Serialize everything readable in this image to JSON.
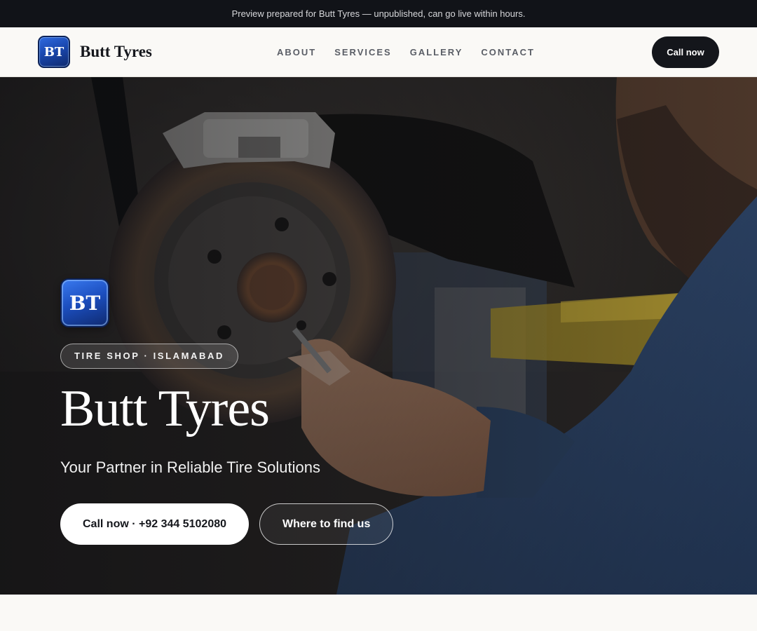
{
  "announcement": "Preview prepared for Butt Tyres — unpublished, can go live within hours.",
  "brand": {
    "logo_text": "BT",
    "name": "Butt Tyres"
  },
  "nav": {
    "links": [
      "ABOUT",
      "SERVICES",
      "GALLERY",
      "CONTACT"
    ],
    "cta": "Call now"
  },
  "hero": {
    "logo_text": "BT",
    "tag": "TIRE SHOP · ISLAMABAD",
    "title": "Butt Tyres",
    "subtitle": "Your Partner in Reliable Tire Solutions",
    "primary_cta": "Call now · +92 344 5102080",
    "secondary_cta": "Where to find us",
    "background_image": "mechanic-brake-disc-photo"
  },
  "colors": {
    "topbar": "#111318",
    "page_bg": "#faf9f6",
    "dark_button": "#14161b",
    "logo_blue": "#1a48b0"
  }
}
